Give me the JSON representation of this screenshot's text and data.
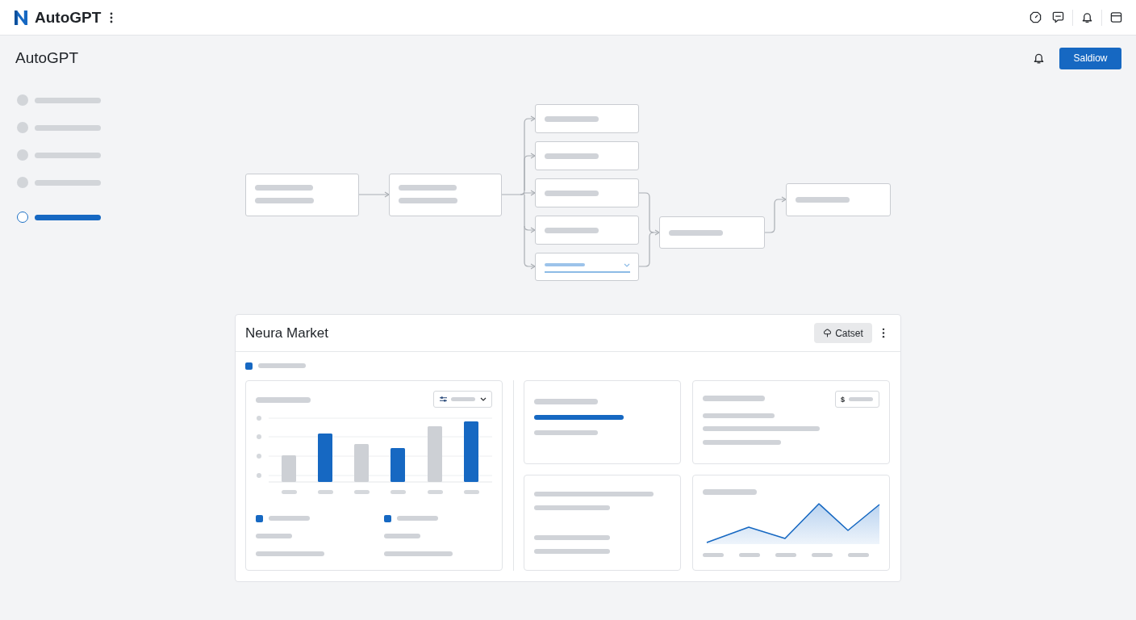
{
  "top_bar": {
    "app_name": "AutoGPT"
  },
  "header": {
    "title": "AutoGPT",
    "button": "Saldiow"
  },
  "sidebar": {
    "items": [
      {
        "selected": false
      },
      {
        "selected": false
      },
      {
        "selected": false
      },
      {
        "selected": false
      },
      {
        "selected": true
      }
    ]
  },
  "flow": {
    "nodes": [
      {
        "kind": "double"
      },
      {
        "kind": "double"
      },
      {
        "kind": "single"
      },
      {
        "kind": "single"
      },
      {
        "kind": "single"
      },
      {
        "kind": "single"
      },
      {
        "kind": "select"
      },
      {
        "kind": "single"
      },
      {
        "kind": "single"
      }
    ]
  },
  "market_card": {
    "title": "Neura Market",
    "button": "Catset",
    "price_filter": {
      "symbol": "$"
    }
  }
}
